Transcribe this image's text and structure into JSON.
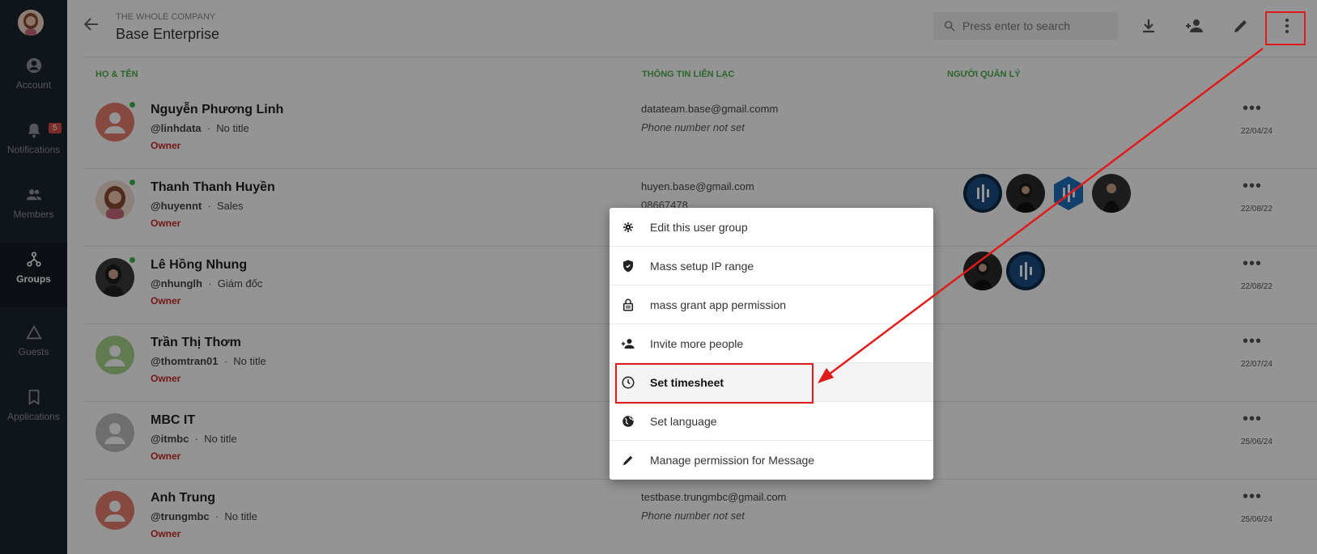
{
  "sidebar": {
    "items": [
      {
        "label": "Account",
        "icon": "account-icon"
      },
      {
        "label": "Notifications",
        "icon": "bell-icon",
        "badge": "5"
      },
      {
        "label": "Members",
        "icon": "members-icon"
      },
      {
        "label": "Groups",
        "icon": "groups-icon",
        "active": true
      },
      {
        "label": "Guests",
        "icon": "guests-icon"
      },
      {
        "label": "Applications",
        "icon": "bookmark-icon"
      }
    ]
  },
  "header": {
    "company": "THE WHOLE COMPANY",
    "group_name": "Base Enterprise",
    "search_placeholder": "Press enter to search"
  },
  "columns": {
    "name": "HỌ & TÊN",
    "contact": "THÔNG TIN LIÊN LẠC",
    "manager": "NGƯỜI QUẢN LÝ"
  },
  "members": [
    {
      "name": "Nguyễn Phương Linh",
      "username": "@linhdata",
      "title": "No title",
      "role": "Owner",
      "email": "datateam.base@gmail.comm",
      "phone": "Phone number not set",
      "date": "22/04/24"
    },
    {
      "name": "Thanh Thanh Huyền",
      "username": "@huyennt",
      "title": "Sales",
      "role": "Owner",
      "email": "huyen.base@gmail.com",
      "phone": "08667478",
      "date": "22/08/22"
    },
    {
      "name": "Lê Hồng Nhung",
      "username": "@nhunglh",
      "title": "Giám đốc",
      "role": "Owner",
      "email": "",
      "phone": "",
      "date": "22/08/22"
    },
    {
      "name": "Trần Thị Thơm",
      "username": "@thomtran01",
      "title": "No title",
      "role": "Owner",
      "email": "",
      "phone": "",
      "date": "22/07/24"
    },
    {
      "name": "MBC IT",
      "username": "@itmbc",
      "title": "No title",
      "role": "Owner",
      "email": "",
      "phone": "",
      "date": "25/06/24"
    },
    {
      "name": "Anh Trung",
      "username": "@trungmbc",
      "title": "No title",
      "role": "Owner",
      "email": "testbase.trungmbc@gmail.com",
      "phone": "Phone number not set",
      "date": "25/06/24"
    }
  ],
  "menu": {
    "items": [
      {
        "label": "Edit this user group",
        "icon": "gear-icon"
      },
      {
        "label": "Mass setup IP range",
        "icon": "shield-icon"
      },
      {
        "label": "mass grant app permission",
        "icon": "lock-icon"
      },
      {
        "label": "Invite more people",
        "icon": "person-add-icon"
      },
      {
        "label": "Set timesheet",
        "icon": "clock-icon",
        "selected": true
      },
      {
        "label": "Set language",
        "icon": "globe-icon"
      },
      {
        "label": "Manage permission for Message",
        "icon": "pencil-icon"
      }
    ]
  },
  "colors": {
    "sidebar_bg": "#1d2430",
    "accent_green": "#4caf50",
    "owner_red": "#c62828",
    "annotation_red": "#e01b1b"
  }
}
